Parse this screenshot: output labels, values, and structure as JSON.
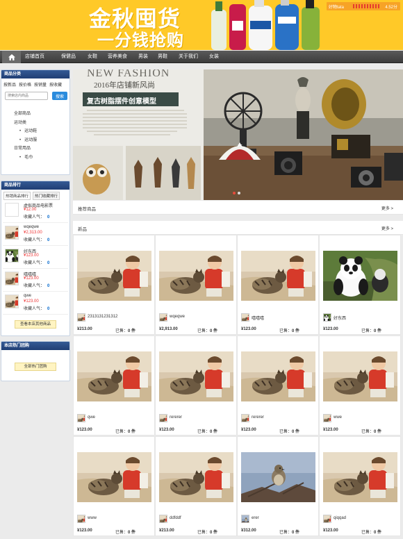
{
  "banner": {
    "headline": "金秋囤货",
    "subline": "一分钱抢购",
    "shop_name": "好物tata",
    "shop_score": "4.52分"
  },
  "nav": {
    "home_icon": "home-icon",
    "items": [
      "店铺首页",
      "保健品",
      "女鞋",
      "营养美食",
      "男装",
      "男鞋",
      "关于我们",
      "女装"
    ]
  },
  "sidebar": {
    "category_title": "商品分类",
    "category_tabs": [
      "按新品",
      "按价格",
      "按销量",
      "按收藏"
    ],
    "search_placeholder": "搜索店内商品",
    "search_button": "搜索",
    "tree": [
      {
        "label": "全部商品",
        "sub": false
      },
      {
        "label": "运动类",
        "sub": false
      },
      {
        "label": "运动鞋",
        "sub": true
      },
      {
        "label": "运动服",
        "sub": true
      },
      {
        "label": "日常用品",
        "sub": false
      },
      {
        "label": "毛巾",
        "sub": true
      }
    ],
    "rank_title": "商品排行",
    "rank_tabs": [
      "热销商品排行",
      "热门收藏排行"
    ],
    "rank_items": [
      {
        "name": "虚拟商品电影票",
        "price": "¥12.00",
        "pop_label": "收藏人气：",
        "pop": "0",
        "thumb": "blank"
      },
      {
        "name": "wqeqwe",
        "price": "¥2,313.00",
        "pop_label": "收藏人气：",
        "pop": "0",
        "thumb": "cat"
      },
      {
        "name": "好东西",
        "price": "¥123.00",
        "pop_label": "收藏人气：",
        "pop": "0",
        "thumb": "panda"
      },
      {
        "name": "嘻嘻嘻",
        "price": "¥123.00",
        "pop_label": "收藏人气：",
        "pop": "0",
        "thumb": "cat"
      },
      {
        "name": "qwe",
        "price": "¥123.00",
        "pop_label": "收藏人气：",
        "pop": "0",
        "thumb": "cat"
      }
    ],
    "rank_more": "查看本店其他商品",
    "group_title": "本店热门团购",
    "group_more": "全部热门团购"
  },
  "hero": {
    "headline": "NEW FASHION",
    "line1": "2016年店铺新风尚",
    "line2": "复古树脂摆件创意模型"
  },
  "sections": {
    "recommend": "推荐商品",
    "new": "新品",
    "more": "更多 >"
  },
  "products": [
    {
      "name": "2313131231312",
      "price": "¥213.00",
      "sold_label": "已售：",
      "sold": "0 件",
      "img": "cat"
    },
    {
      "name": "wqeqwe",
      "price": "¥2,913.00",
      "sold_label": "已售：",
      "sold": "0 件",
      "img": "cat"
    },
    {
      "name": "嘻嘻嘻",
      "price": "¥123.00",
      "sold_label": "已售：",
      "sold": "0 件",
      "img": "cat"
    },
    {
      "name": "好东西",
      "price": "¥123.00",
      "sold_label": "已售：",
      "sold": "0 件",
      "img": "panda"
    },
    {
      "name": "qwe",
      "price": "¥123.00",
      "sold_label": "已售：",
      "sold": "0 件",
      "img": "cat"
    },
    {
      "name": "rererer",
      "price": "¥123.00",
      "sold_label": "已售：",
      "sold": "0 件",
      "img": "cat"
    },
    {
      "name": "rererer",
      "price": "¥123.00",
      "sold_label": "已售：",
      "sold": "0 件",
      "img": "cat"
    },
    {
      "name": "wwe",
      "price": "¥123.00",
      "sold_label": "已售：",
      "sold": "0 件",
      "img": "cat"
    },
    {
      "name": "www",
      "price": "¥123.00",
      "sold_label": "已售：",
      "sold": "0 件",
      "img": "cat"
    },
    {
      "name": "ddfddf",
      "price": "¥213.00",
      "sold_label": "已售：",
      "sold": "0 件",
      "img": "cat"
    },
    {
      "name": "erer",
      "price": "¥312.00",
      "sold_label": "已售：",
      "sold": "0 件",
      "img": "bird"
    },
    {
      "name": "qiqqad",
      "price": "¥123.00",
      "sold_label": "已售：",
      "sold": "0 件",
      "img": "cat"
    }
  ],
  "colors": {
    "banner": "#ffc928",
    "nav": "#4a4a4a",
    "panel_head": "#2b4b85",
    "price_red": "#e33333",
    "search_blue": "#2a8bdd"
  }
}
